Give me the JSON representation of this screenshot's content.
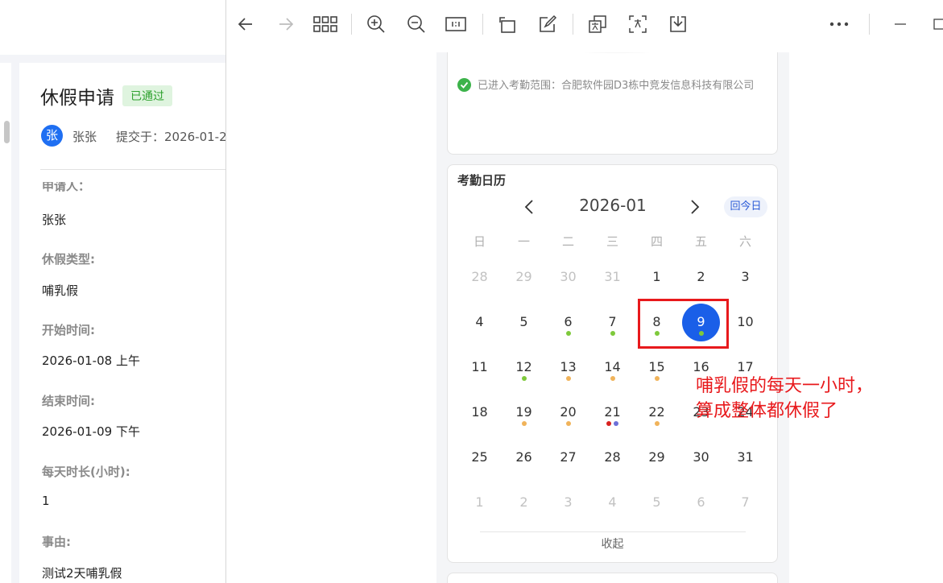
{
  "request": {
    "title": "休假申请",
    "status": "已通过",
    "avatar_char": "张",
    "user": "张张",
    "submitted": "提交于：2026-01-2",
    "cut_label": "申请人：",
    "fields": [
      {
        "label": "",
        "value": "张张"
      },
      {
        "label": "休假类型:",
        "value": "哺乳假"
      },
      {
        "label": "开始时间:",
        "value": "2026-01-08 上午"
      },
      {
        "label": "结束时间:",
        "value": "2026-01-09 下午"
      },
      {
        "label": "每天时长(小时):",
        "value": "1"
      },
      {
        "label": "事由:",
        "value": "测试2天哺乳假"
      }
    ]
  },
  "viewer": {
    "toolbar": [
      "back-icon",
      "forward-icon",
      "grid-icon",
      "zoom-in-icon",
      "zoom-out-icon",
      "actual-size-icon",
      "rotate-icon",
      "edit-icon",
      "copy-image-icon",
      "ocr-text-icon",
      "download-icon",
      "more-icon",
      "minimize-icon",
      "maximize-icon"
    ]
  },
  "attendance": {
    "text": "已进入考勤范围：合肥软件园D3栋中竞发信息科技有限公司"
  },
  "calendar": {
    "title": "考勤日历",
    "month": "2026-01",
    "today_button": "回今日",
    "weekdays": [
      "日",
      "一",
      "二",
      "三",
      "四",
      "五",
      "六"
    ],
    "weeks": [
      [
        {
          "d": "28",
          "o": true
        },
        {
          "d": "29",
          "o": true
        },
        {
          "d": "30",
          "o": true
        },
        {
          "d": "31",
          "o": true
        },
        {
          "d": "1"
        },
        {
          "d": "2"
        },
        {
          "d": "3"
        }
      ],
      [
        {
          "d": "4"
        },
        {
          "d": "5"
        },
        {
          "d": "6",
          "dots": [
            "#7ec93b"
          ]
        },
        {
          "d": "7",
          "dots": [
            "#7ec93b"
          ]
        },
        {
          "d": "8",
          "dots": [
            "#7ec93b"
          ]
        },
        {
          "d": "9",
          "dots": [
            "#7ec93b"
          ],
          "sel": true
        },
        {
          "d": "10"
        }
      ],
      [
        {
          "d": "11"
        },
        {
          "d": "12",
          "dots": [
            "#7ec93b"
          ]
        },
        {
          "d": "13",
          "dots": [
            "#f0b35a"
          ]
        },
        {
          "d": "14",
          "dots": [
            "#f0b35a"
          ]
        },
        {
          "d": "15",
          "dots": [
            "#f0b35a"
          ]
        },
        {
          "d": "16"
        },
        {
          "d": "17"
        }
      ],
      [
        {
          "d": "18"
        },
        {
          "d": "19",
          "dots": [
            "#f0b35a"
          ]
        },
        {
          "d": "20",
          "dots": [
            "#f0b35a"
          ]
        },
        {
          "d": "21",
          "dots": [
            "#d9211f",
            "#6c6fd8"
          ]
        },
        {
          "d": "22",
          "dots": [
            "#f0b35a"
          ]
        },
        {
          "d": "23"
        },
        {
          "d": "24"
        }
      ],
      [
        {
          "d": "25"
        },
        {
          "d": "26"
        },
        {
          "d": "27"
        },
        {
          "d": "28"
        },
        {
          "d": "29"
        },
        {
          "d": "30"
        },
        {
          "d": "31"
        }
      ],
      [
        {
          "d": "1",
          "o": true
        },
        {
          "d": "2",
          "o": true
        },
        {
          "d": "3",
          "o": true
        },
        {
          "d": "4",
          "o": true
        },
        {
          "d": "5",
          "o": true
        },
        {
          "d": "6",
          "o": true
        },
        {
          "d": "7",
          "o": true
        }
      ]
    ],
    "collapse": "收起"
  },
  "annotation": {
    "line1": "哺乳假的每天一小时，",
    "line2": "算成整体都休假了"
  },
  "colors": {
    "accent": "#1a5fe8",
    "annotation_red": "#e8191c",
    "status_green": "#2da12d"
  }
}
